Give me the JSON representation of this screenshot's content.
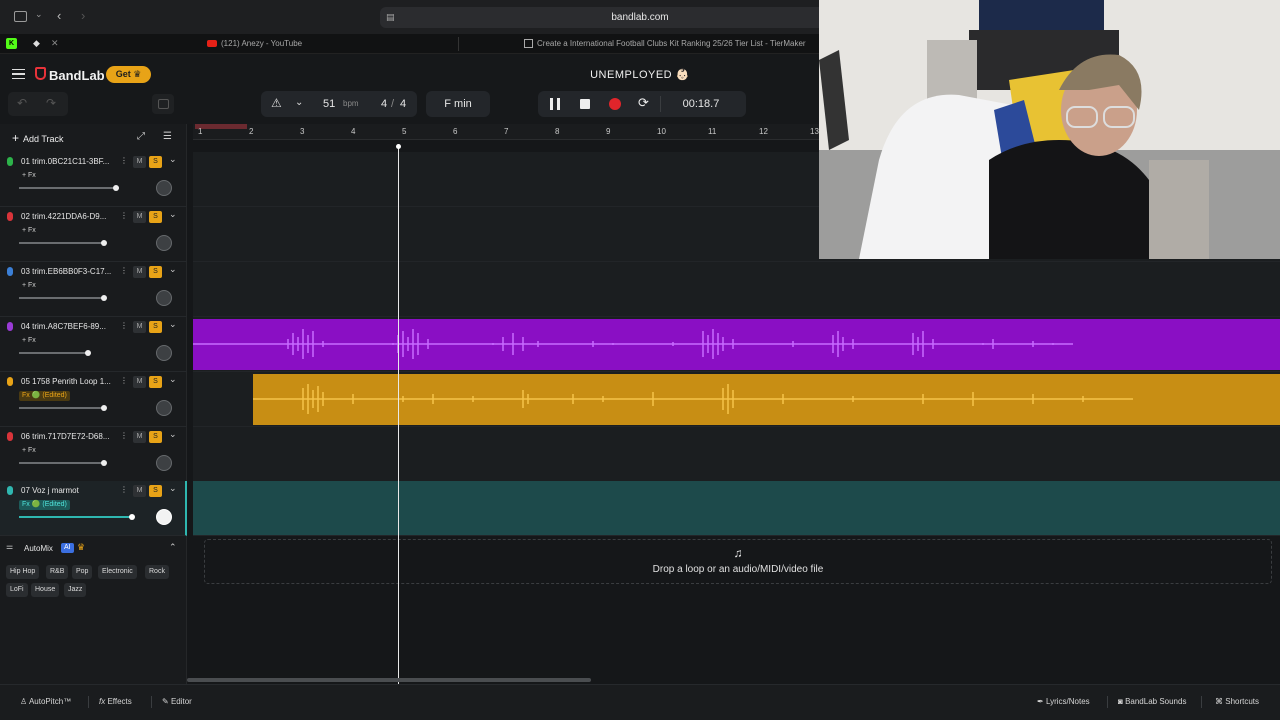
{
  "browser": {
    "url": "bandlab.com",
    "tabs": [
      {
        "label": "(121) Anezy - YouTube"
      },
      {
        "label": "Create a International Football Clubs Kit Ranking 25/26 Tier List - TierMaker"
      }
    ]
  },
  "header": {
    "brand": "BandLab",
    "get_label": "Get",
    "project_title": "UNEMPLOYED 👶🏻"
  },
  "transport": {
    "bpm": "51",
    "bpm_unit": "bpm",
    "time_sig_num": "4",
    "time_sig_sep": "/",
    "time_sig_den": "4",
    "key": "F min",
    "time": "00:18.7"
  },
  "left": {
    "add_track": "Add Track",
    "tracks": [
      {
        "name": "01  trim.0BC21C11-3BF...",
        "fx": "+ Fx",
        "mic_color": "#2db34a"
      },
      {
        "name": "02  trim.4221DDA6-D9...",
        "fx": "+ Fx",
        "mic_color": "#d9343a"
      },
      {
        "name": "03  trim.EB6BB0F3-C17...",
        "fx": "+ Fx",
        "mic_color": "#3b7fd6"
      },
      {
        "name": "04  trim.A8C7BEF6-89...",
        "fx": "+ Fx",
        "mic_color": "#9a3bd6"
      },
      {
        "name": "05  1758 Penrith Loop 1...",
        "fx": "Fx 🟢 (Edited)",
        "mic_color": "#e8a317"
      },
      {
        "name": "06  trim.717D7E72-D68...",
        "fx": "+ Fx",
        "mic_color": "#d9343a"
      },
      {
        "name": "07  Voz j marmot",
        "fx": "Fx 🟢 (Edited)",
        "mic_color": "#2fb7b0"
      }
    ],
    "m_label": "M",
    "s_label": "S",
    "automix": {
      "title": "AutoMix",
      "ai_badge": "AI",
      "genres_row1": [
        "Hip Hop",
        "R&B",
        "Pop",
        "Electronic",
        "Rock"
      ],
      "genres_row2": [
        "LoFi",
        "House",
        "Jazz"
      ]
    }
  },
  "ruler": [
    "1",
    "2",
    "3",
    "4",
    "5",
    "6",
    "7",
    "8",
    "9",
    "10",
    "11",
    "12",
    "13"
  ],
  "drop_zone": {
    "text": "Drop a loop or an audio/MIDI/video file"
  },
  "bottom": {
    "autopitch": "AutoPitch™",
    "effects": "Effects",
    "editor": "Editor",
    "lyrics": "Lyrics/Notes",
    "sounds": "BandLab Sounds",
    "shortcuts": "Shortcuts"
  },
  "colors": {
    "accent": "#e8a317",
    "purple_clip": "#8a0fc4",
    "orange_clip": "#c88e14",
    "teal_lane": "#1d4a4b",
    "record": "#e0252b"
  }
}
